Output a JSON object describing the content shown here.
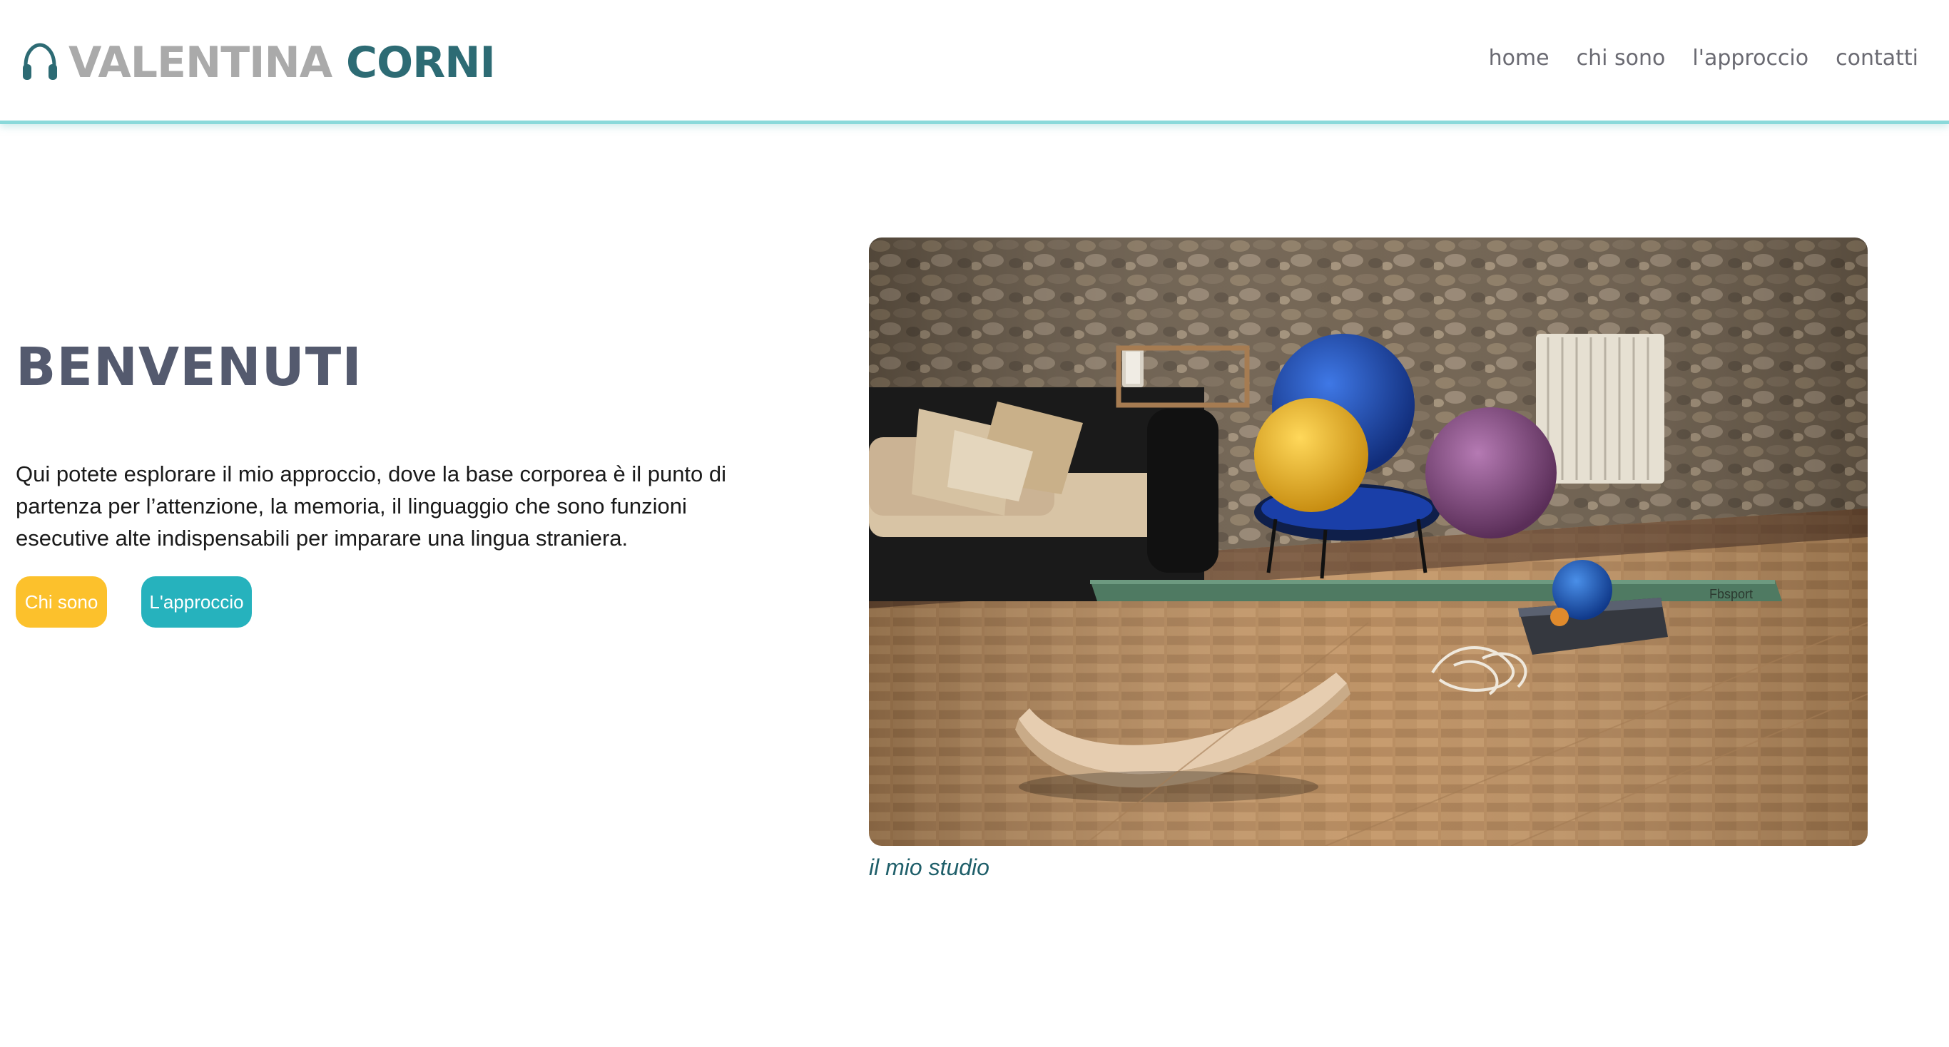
{
  "header": {
    "logo": {
      "icon": "headphones-icon",
      "first_name": "VALENTINA",
      "last_name": "CORNI"
    },
    "nav": [
      "home",
      "chi sono",
      "l'approccio",
      "contatti"
    ]
  },
  "hero": {
    "title": "BENVENUTI",
    "text": "Qui potete esplorare il mio approccio, dove la base corporea è il punto di partenza per l’attenzione, la memoria, il linguaggio che sono funzioni esecutive alte indispensabili per imparare una lingua straniera.",
    "buttons": [
      "Chi sono",
      "L'approccio"
    ]
  },
  "image": {
    "caption": "il mio studio",
    "balance_beam_brand": "Fbsport"
  },
  "colors": {
    "logo_gray": "#aaaaaa",
    "logo_teal": "#2d6b74",
    "header_border": "#8ad9da",
    "title": "#545a6e",
    "button_yellow": "#fcc12c",
    "button_teal": "#26b2bd",
    "caption": "#1f5f6a"
  }
}
